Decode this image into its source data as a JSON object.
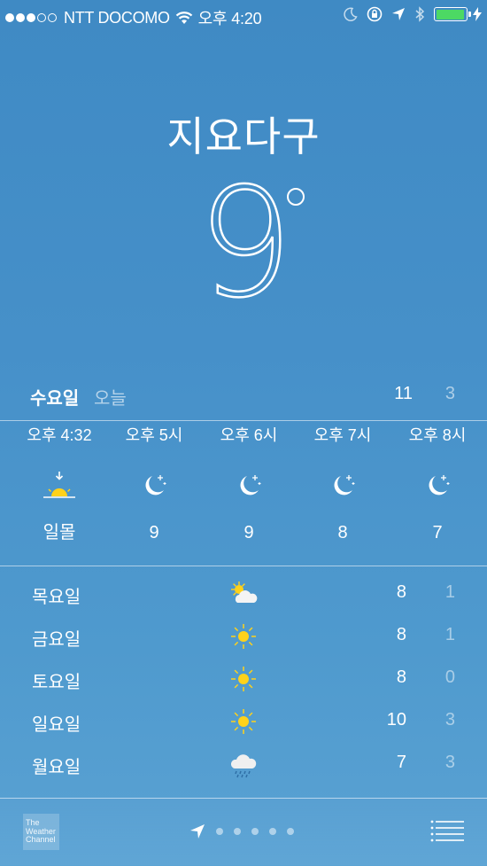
{
  "status_bar": {
    "signal_dots_full": 3,
    "signal_dots_total": 5,
    "carrier": "NTT DOCOMO",
    "time": "오후 4:20",
    "battery_level": 0.95,
    "battery_color": "#4cd964",
    "icons": [
      "wifi-icon",
      "moon-icon",
      "rotation-lock-icon",
      "location-arrow-icon",
      "bluetooth-icon",
      "battery-icon",
      "charging-icon"
    ]
  },
  "location": {
    "city": "지요다구",
    "temperature": "9"
  },
  "today": {
    "day": "수요일",
    "label": "오늘",
    "high": "11",
    "low": "3"
  },
  "hourly": [
    {
      "time": "오후 4:32",
      "icon": "sunset-icon",
      "value": "일몰"
    },
    {
      "time": "오후 5시",
      "icon": "moon-stars-icon",
      "value": "9"
    },
    {
      "time": "오후 6시",
      "icon": "moon-stars-icon",
      "value": "9"
    },
    {
      "time": "오후 7시",
      "icon": "moon-stars-icon",
      "value": "8"
    },
    {
      "time": "오후 8시",
      "icon": "moon-stars-icon",
      "value": "7"
    }
  ],
  "daily": [
    {
      "day": "목요일",
      "icon": "partly-cloudy-icon",
      "high": "8",
      "low": "1"
    },
    {
      "day": "금요일",
      "icon": "sun-icon",
      "high": "8",
      "low": "1"
    },
    {
      "day": "토요일",
      "icon": "sun-icon",
      "high": "8",
      "low": "0"
    },
    {
      "day": "일요일",
      "icon": "sun-icon",
      "high": "10",
      "low": "3"
    },
    {
      "day": "월요일",
      "icon": "rain-cloud-icon",
      "high": "7",
      "low": "3"
    }
  ],
  "footer": {
    "logo_line1": "The",
    "logo_line2": "Weather",
    "logo_line3": "Channel",
    "page_count": 5,
    "icons": [
      "location-arrow-icon",
      "list-icon"
    ]
  },
  "colors": {
    "background_top": "#3f8ac4",
    "background_bottom": "#5aa2d3",
    "sun_yellow": "#ffd21a"
  }
}
